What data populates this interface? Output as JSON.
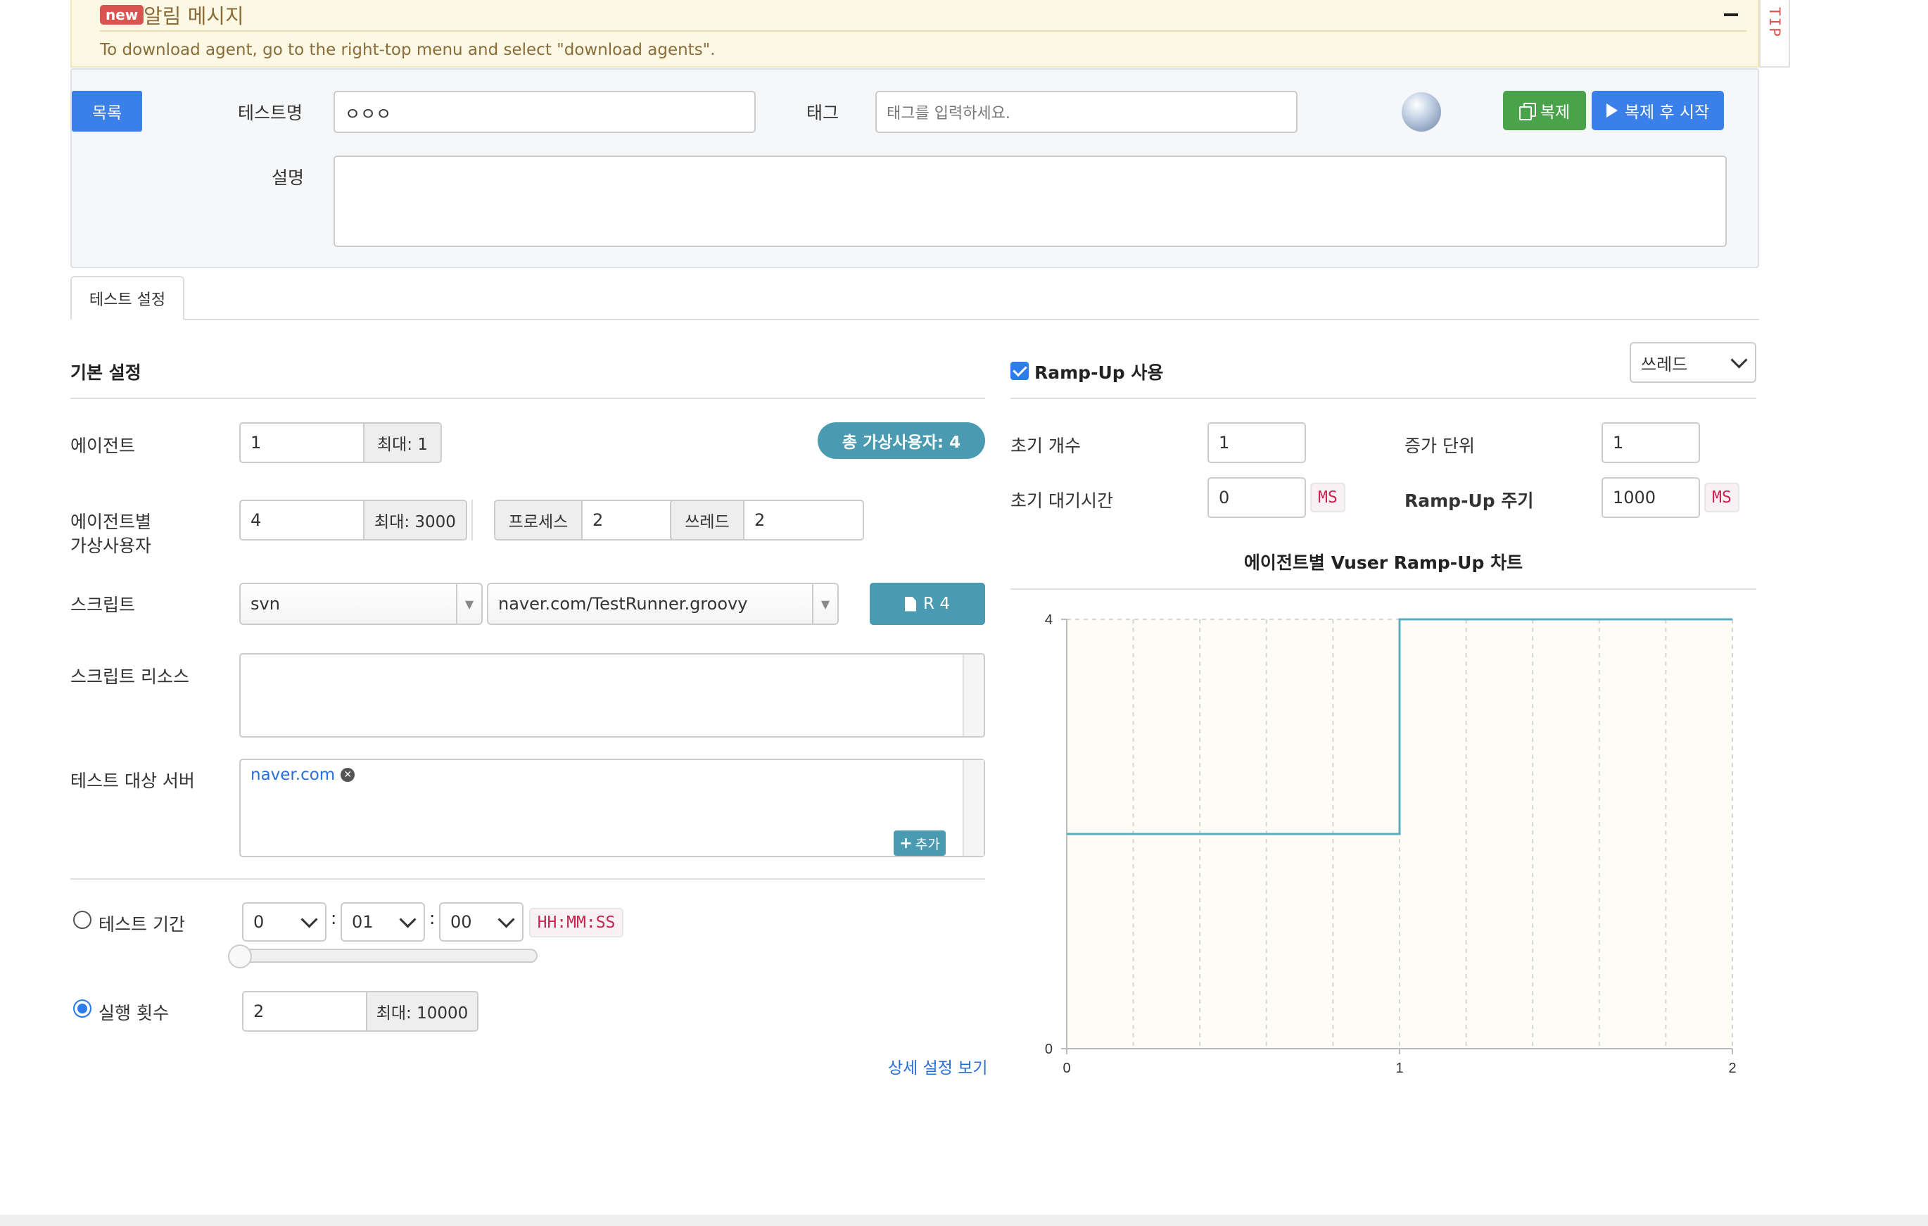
{
  "alert": {
    "badge": "new",
    "title": "알림 메시지",
    "collapse_symbol": "−",
    "message": "To download agent, go to the right-top menu and select \"download agents\".",
    "tip_tab": "TIP"
  },
  "header": {
    "list_button": "목록",
    "test_name_label": "테스트명",
    "test_name_value": "ㅇㅇㅇ",
    "tag_label": "태그",
    "tag_placeholder": "태그를 입력하세요.",
    "clone_button": "복제",
    "clone_start_button": "복제 후 시작",
    "description_label": "설명",
    "description_value": ""
  },
  "tabs": [
    {
      "label": "테스트 설정"
    }
  ],
  "basic": {
    "section_title": "기본 설정",
    "total_vusers_badge": "총 가상사용자: 4",
    "agent": {
      "label": "에이전트",
      "value": "1",
      "max": "최대: 1"
    },
    "vuser": {
      "label_line1": "에이전트별",
      "label_line2": "가상사용자",
      "value": "4",
      "max": "최대: 3000",
      "process_label": "프로세스",
      "process_value": "2",
      "thread_label": "쓰레드",
      "thread_value": "2"
    },
    "script": {
      "label": "스크립트",
      "repo": "svn",
      "file": "naver.com/TestRunner.groovy",
      "revision_button": "R 4"
    },
    "script_resource": {
      "label": "스크립트 리소스",
      "value": ""
    },
    "target_server": {
      "label": "테스트 대상 서버",
      "hosts": [
        "naver.com"
      ],
      "add_button": "추가"
    },
    "duration": {
      "label": "테스트 기간",
      "checked": false,
      "hours": "0",
      "minutes": "01",
      "seconds": "00",
      "separator": ":",
      "format": "HH:MM:SS",
      "slider_level": 0
    },
    "run_count": {
      "label": "실행 횟수",
      "checked": true,
      "value": "2",
      "max": "최대: 10000"
    },
    "detail_link": "상세 설정 보기"
  },
  "rampup": {
    "enabled": true,
    "title": "Ramp-Up 사용",
    "type_select": "쓰레드",
    "initial_count": {
      "label": "초기 개수",
      "value": "1"
    },
    "increment": {
      "label": "증가 단위",
      "value": "1"
    },
    "initial_sleep": {
      "label": "초기 대기시간",
      "value": "0",
      "unit": "MS"
    },
    "interval": {
      "label": "Ramp-Up 주기",
      "value": "1000",
      "unit": "MS"
    }
  },
  "chart_data": {
    "type": "line",
    "title": "에이전트별 Vuser Ramp-Up 차트",
    "xlim": [
      0,
      2
    ],
    "ylim": [
      0,
      4
    ],
    "x_ticks": [
      "0",
      "1",
      "2"
    ],
    "y_ticks": [
      "0",
      "4"
    ],
    "step": true,
    "series": [
      {
        "x": [
          0,
          1,
          1,
          2
        ],
        "values": [
          2,
          2,
          4,
          4
        ]
      }
    ],
    "grid": true,
    "colors": {
      "line": "#5aacbf",
      "plot_bg": "#fdfcf5",
      "grid": "#d6d6d6"
    }
  },
  "colors": {
    "primary": "#3b80e8",
    "success": "#4aa24a",
    "info": "#4a9bb1",
    "badge_red": "#d9534f",
    "alert_bg": "#fcf8e3",
    "alert_text": "#8a6d3b"
  }
}
